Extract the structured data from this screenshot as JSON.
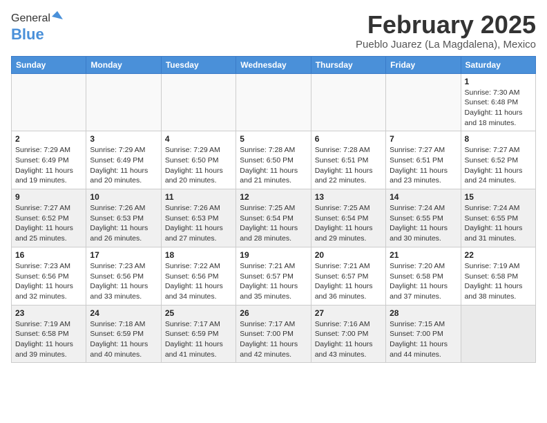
{
  "header": {
    "logo_general": "General",
    "logo_blue": "Blue",
    "month_title": "February 2025",
    "location": "Pueblo Juarez (La Magdalena), Mexico"
  },
  "days_of_week": [
    "Sunday",
    "Monday",
    "Tuesday",
    "Wednesday",
    "Thursday",
    "Friday",
    "Saturday"
  ],
  "weeks": [
    {
      "shaded": false,
      "days": [
        {
          "num": "",
          "info": ""
        },
        {
          "num": "",
          "info": ""
        },
        {
          "num": "",
          "info": ""
        },
        {
          "num": "",
          "info": ""
        },
        {
          "num": "",
          "info": ""
        },
        {
          "num": "",
          "info": ""
        },
        {
          "num": "1",
          "info": "Sunrise: 7:30 AM\nSunset: 6:48 PM\nDaylight: 11 hours and 18 minutes."
        }
      ]
    },
    {
      "shaded": false,
      "days": [
        {
          "num": "2",
          "info": "Sunrise: 7:29 AM\nSunset: 6:49 PM\nDaylight: 11 hours and 19 minutes."
        },
        {
          "num": "3",
          "info": "Sunrise: 7:29 AM\nSunset: 6:49 PM\nDaylight: 11 hours and 20 minutes."
        },
        {
          "num": "4",
          "info": "Sunrise: 7:29 AM\nSunset: 6:50 PM\nDaylight: 11 hours and 20 minutes."
        },
        {
          "num": "5",
          "info": "Sunrise: 7:28 AM\nSunset: 6:50 PM\nDaylight: 11 hours and 21 minutes."
        },
        {
          "num": "6",
          "info": "Sunrise: 7:28 AM\nSunset: 6:51 PM\nDaylight: 11 hours and 22 minutes."
        },
        {
          "num": "7",
          "info": "Sunrise: 7:27 AM\nSunset: 6:51 PM\nDaylight: 11 hours and 23 minutes."
        },
        {
          "num": "8",
          "info": "Sunrise: 7:27 AM\nSunset: 6:52 PM\nDaylight: 11 hours and 24 minutes."
        }
      ]
    },
    {
      "shaded": true,
      "days": [
        {
          "num": "9",
          "info": "Sunrise: 7:27 AM\nSunset: 6:52 PM\nDaylight: 11 hours and 25 minutes."
        },
        {
          "num": "10",
          "info": "Sunrise: 7:26 AM\nSunset: 6:53 PM\nDaylight: 11 hours and 26 minutes."
        },
        {
          "num": "11",
          "info": "Sunrise: 7:26 AM\nSunset: 6:53 PM\nDaylight: 11 hours and 27 minutes."
        },
        {
          "num": "12",
          "info": "Sunrise: 7:25 AM\nSunset: 6:54 PM\nDaylight: 11 hours and 28 minutes."
        },
        {
          "num": "13",
          "info": "Sunrise: 7:25 AM\nSunset: 6:54 PM\nDaylight: 11 hours and 29 minutes."
        },
        {
          "num": "14",
          "info": "Sunrise: 7:24 AM\nSunset: 6:55 PM\nDaylight: 11 hours and 30 minutes."
        },
        {
          "num": "15",
          "info": "Sunrise: 7:24 AM\nSunset: 6:55 PM\nDaylight: 11 hours and 31 minutes."
        }
      ]
    },
    {
      "shaded": false,
      "days": [
        {
          "num": "16",
          "info": "Sunrise: 7:23 AM\nSunset: 6:56 PM\nDaylight: 11 hours and 32 minutes."
        },
        {
          "num": "17",
          "info": "Sunrise: 7:23 AM\nSunset: 6:56 PM\nDaylight: 11 hours and 33 minutes."
        },
        {
          "num": "18",
          "info": "Sunrise: 7:22 AM\nSunset: 6:56 PM\nDaylight: 11 hours and 34 minutes."
        },
        {
          "num": "19",
          "info": "Sunrise: 7:21 AM\nSunset: 6:57 PM\nDaylight: 11 hours and 35 minutes."
        },
        {
          "num": "20",
          "info": "Sunrise: 7:21 AM\nSunset: 6:57 PM\nDaylight: 11 hours and 36 minutes."
        },
        {
          "num": "21",
          "info": "Sunrise: 7:20 AM\nSunset: 6:58 PM\nDaylight: 11 hours and 37 minutes."
        },
        {
          "num": "22",
          "info": "Sunrise: 7:19 AM\nSunset: 6:58 PM\nDaylight: 11 hours and 38 minutes."
        }
      ]
    },
    {
      "shaded": true,
      "days": [
        {
          "num": "23",
          "info": "Sunrise: 7:19 AM\nSunset: 6:58 PM\nDaylight: 11 hours and 39 minutes."
        },
        {
          "num": "24",
          "info": "Sunrise: 7:18 AM\nSunset: 6:59 PM\nDaylight: 11 hours and 40 minutes."
        },
        {
          "num": "25",
          "info": "Sunrise: 7:17 AM\nSunset: 6:59 PM\nDaylight: 11 hours and 41 minutes."
        },
        {
          "num": "26",
          "info": "Sunrise: 7:17 AM\nSunset: 7:00 PM\nDaylight: 11 hours and 42 minutes."
        },
        {
          "num": "27",
          "info": "Sunrise: 7:16 AM\nSunset: 7:00 PM\nDaylight: 11 hours and 43 minutes."
        },
        {
          "num": "28",
          "info": "Sunrise: 7:15 AM\nSunset: 7:00 PM\nDaylight: 11 hours and 44 minutes."
        },
        {
          "num": "",
          "info": ""
        }
      ]
    }
  ]
}
